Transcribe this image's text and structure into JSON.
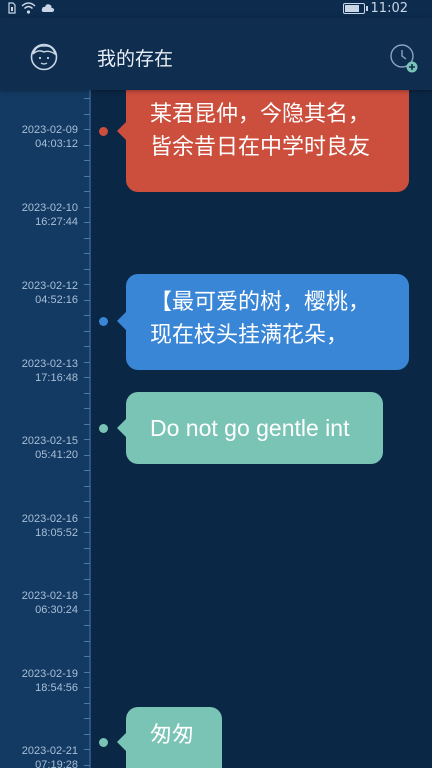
{
  "status_bar": {
    "time": "11:02",
    "sim_icon": "sim-card-icon",
    "wifi_icon": "wifi-icon",
    "cloud_icon": "cloud-icon",
    "battery_level": 0.85
  },
  "app_bar": {
    "title": "我的存在",
    "avatar_icon": "face-avatar-icon",
    "history_icon": "clock-add-icon"
  },
  "timeline": {
    "entries": [
      {
        "date": "2023-02-09",
        "time": "04:03:12"
      },
      {
        "date": "2023-02-10",
        "time": "16:27:44"
      },
      {
        "date": "2023-02-12",
        "time": "04:52:16"
      },
      {
        "date": "2023-02-13",
        "time": "17:16:48"
      },
      {
        "date": "2023-02-15",
        "time": "05:41:20"
      },
      {
        "date": "2023-02-16",
        "time": "18:05:52"
      },
      {
        "date": "2023-02-18",
        "time": "06:30:24"
      },
      {
        "date": "2023-02-19",
        "time": "18:54:56"
      },
      {
        "date": "2023-02-21",
        "time": "07:19:28"
      }
    ]
  },
  "bubbles": [
    {
      "text": "某君昆仲，今隐其名，皆余昔日在中学时良友",
      "color": "#cc4e3d"
    },
    {
      "text": "【最可爱的树，樱桃， 现在枝头挂满花朵，",
      "color": "#3a86d6"
    },
    {
      "text": "Do not go gentle int",
      "color": "#7ac4b5"
    },
    {
      "text": "匆匆",
      "color": "#7ac4b5"
    }
  ],
  "colors": {
    "background": "#0b2746",
    "timeline_column": "#133a63",
    "app_bar": "#0e2d4f"
  }
}
